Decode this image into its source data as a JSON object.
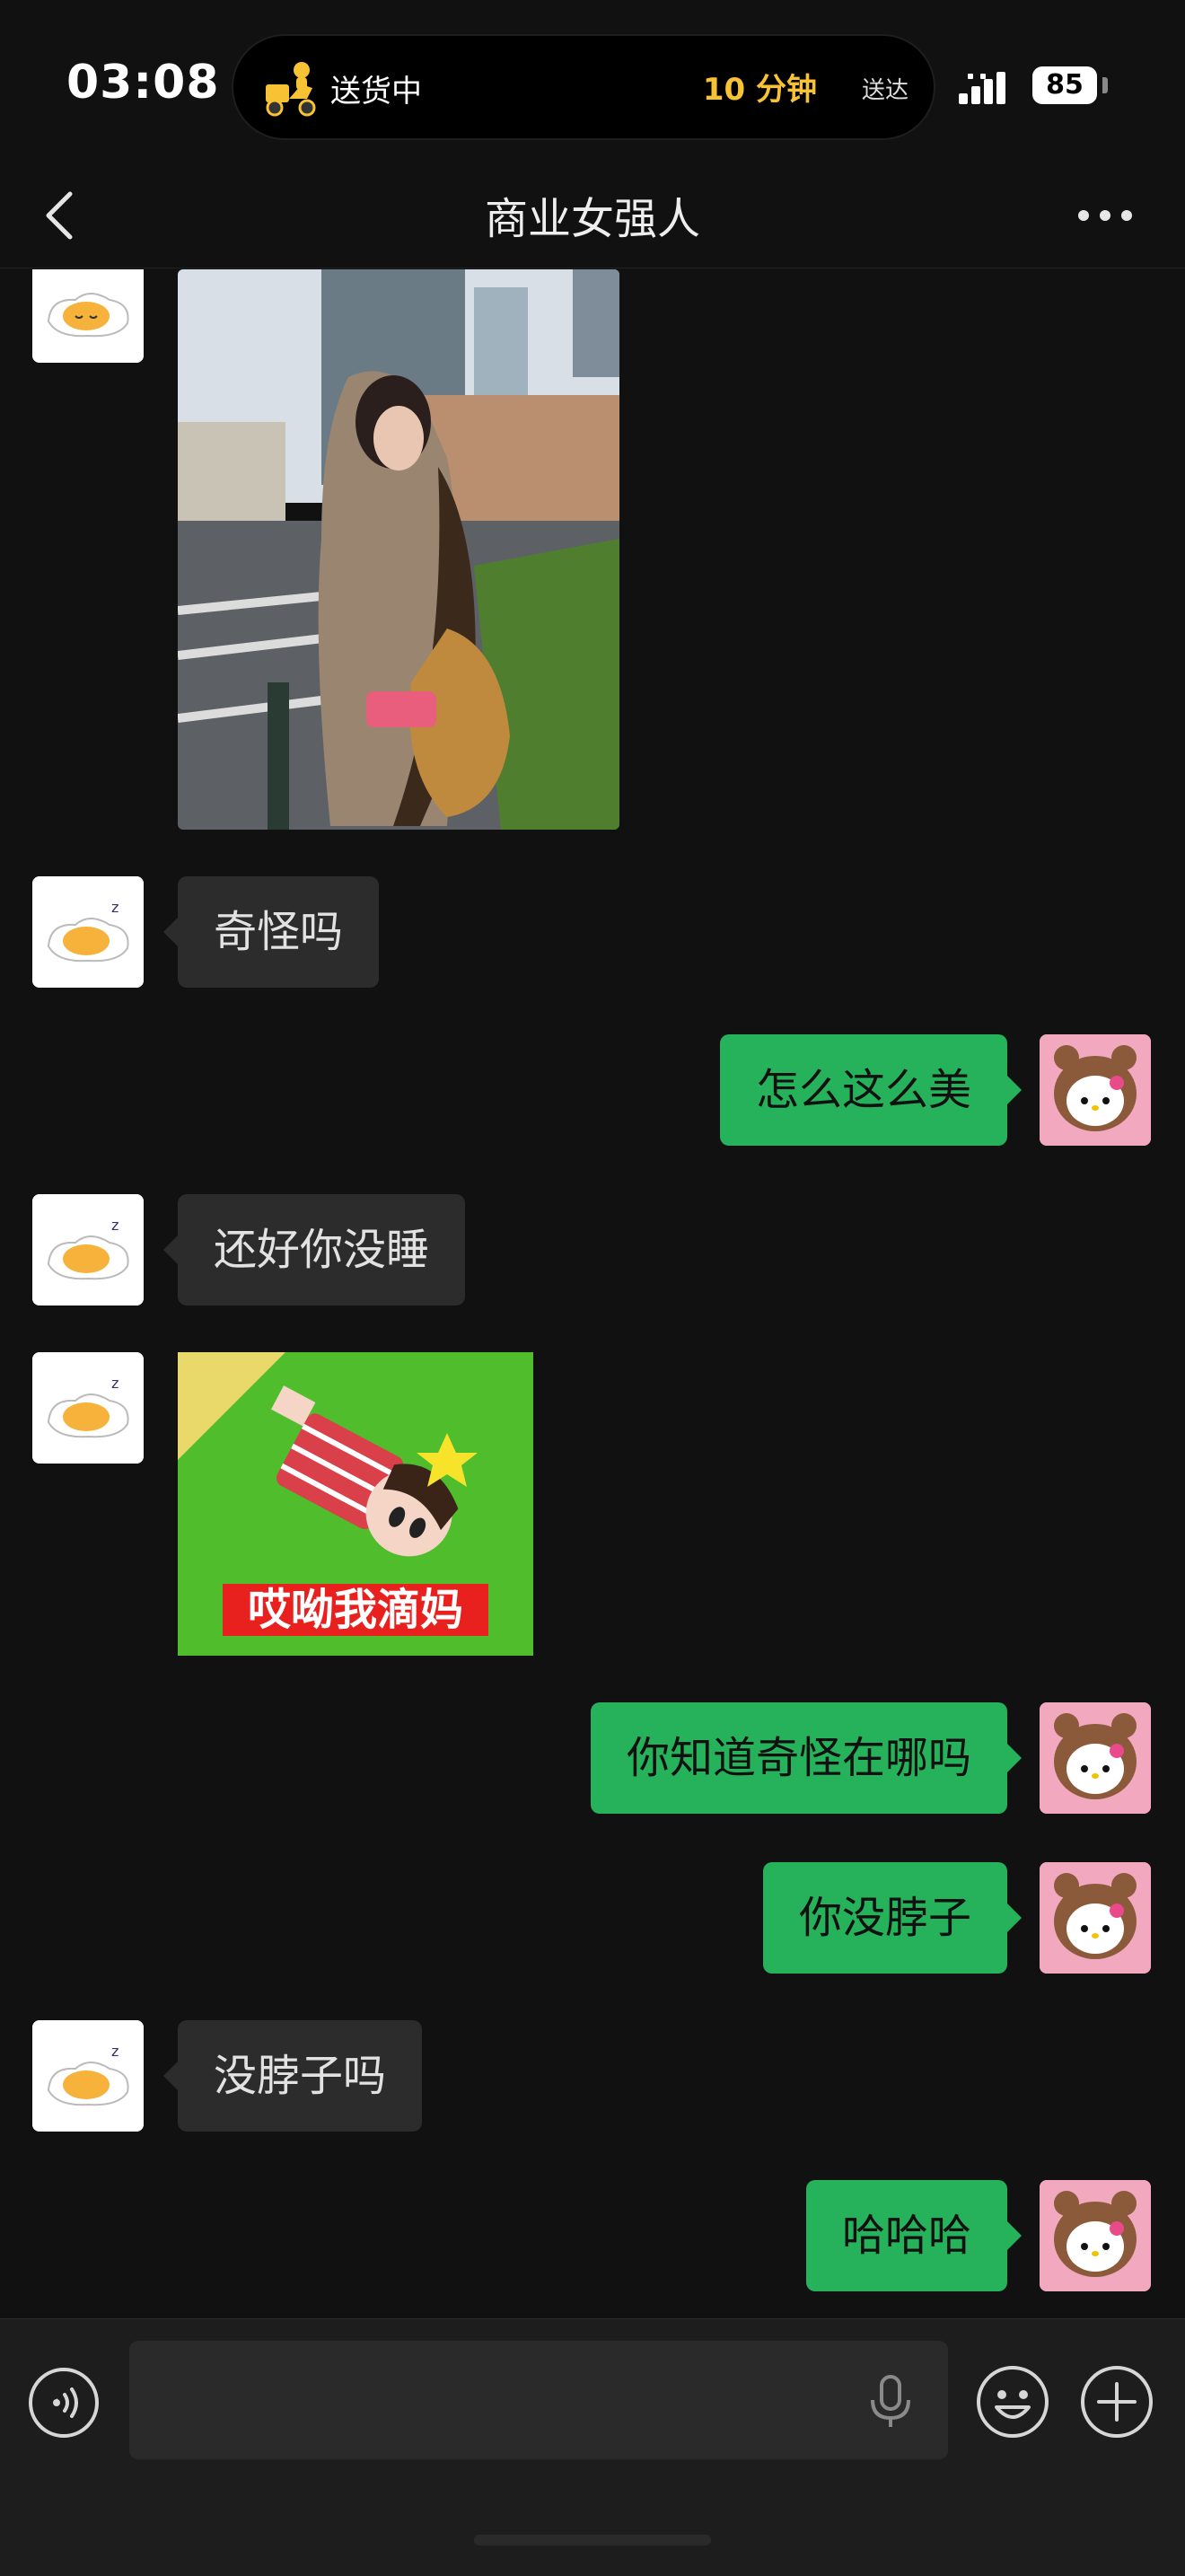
{
  "status_bar": {
    "time": "03:08",
    "activity_label": "送货中",
    "eta": "10 分钟",
    "eta_suffix": "送达",
    "battery": "85",
    "accent_color": "#f7c233"
  },
  "header": {
    "title": "商业女强人",
    "back_icon": "chevron-left-icon",
    "more_icon": "ellipsis-icon"
  },
  "messages": [
    {
      "side": "left",
      "type": "image",
      "avatar": "egg-avatar"
    },
    {
      "side": "left",
      "type": "text",
      "text": "奇怪吗"
    },
    {
      "side": "right",
      "type": "text",
      "text": "怎么这么美"
    },
    {
      "side": "left",
      "type": "text",
      "text": "还好你没睡"
    },
    {
      "side": "left",
      "type": "sticker",
      "caption": "哎呦我滴妈"
    },
    {
      "side": "right",
      "type": "text",
      "text": "你知道奇怪在哪吗"
    },
    {
      "side": "right",
      "type": "text",
      "text": "你没脖子"
    },
    {
      "side": "left",
      "type": "text",
      "text": "没脖子吗"
    },
    {
      "side": "right",
      "type": "text",
      "text": "哈哈哈"
    }
  ],
  "input_bar": {
    "voice_icon": "voice-mode-icon",
    "mic_icon": "microphone-icon",
    "emoji_icon": "emoji-icon",
    "plus_icon": "plus-icon",
    "placeholder": ""
  },
  "colors": {
    "background": "#111111",
    "bubble_incoming": "#2c2c2c",
    "bubble_outgoing": "#26b25a"
  }
}
